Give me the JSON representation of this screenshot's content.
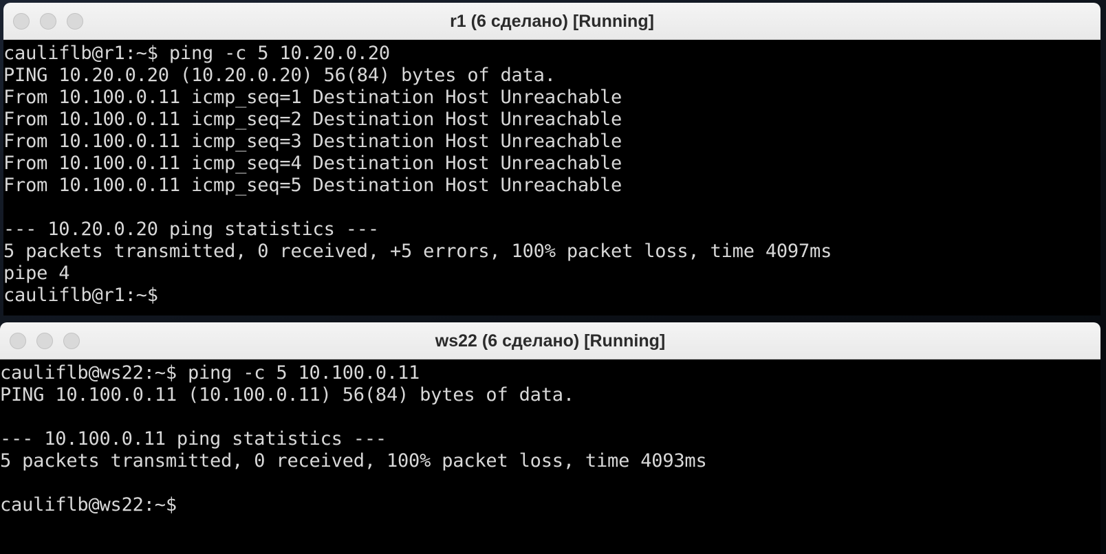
{
  "windows": [
    {
      "title": "r1 (6 сделано) [Running]",
      "lines": [
        "cauliflb@r1:~$ ping -c 5 10.20.0.20",
        "PING 10.20.0.20 (10.20.0.20) 56(84) bytes of data.",
        "From 10.100.0.11 icmp_seq=1 Destination Host Unreachable",
        "From 10.100.0.11 icmp_seq=2 Destination Host Unreachable",
        "From 10.100.0.11 icmp_seq=3 Destination Host Unreachable",
        "From 10.100.0.11 icmp_seq=4 Destination Host Unreachable",
        "From 10.100.0.11 icmp_seq=5 Destination Host Unreachable",
        "",
        "--- 10.20.0.20 ping statistics ---",
        "5 packets transmitted, 0 received, +5 errors, 100% packet loss, time 4097ms",
        "pipe 4",
        "cauliflb@r1:~$"
      ]
    },
    {
      "title": "ws22 (6 сделано) [Running]",
      "lines": [
        "cauliflb@ws22:~$ ping -c 5 10.100.0.11",
        "PING 10.100.0.11 (10.100.0.11) 56(84) bytes of data.",
        "",
        "--- 10.100.0.11 ping statistics ---",
        "5 packets transmitted, 0 received, 100% packet loss, time 4093ms",
        "",
        "cauliflb@ws22:~$"
      ]
    }
  ]
}
